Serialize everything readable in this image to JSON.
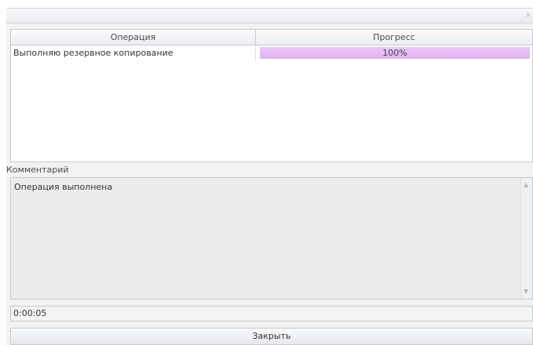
{
  "window": {
    "close_glyph": "×"
  },
  "grid": {
    "columns": [
      "Операция",
      "Прогресс"
    ],
    "rows": [
      {
        "operation": "Выполняю резервное копирование",
        "progress": 1.0,
        "progress_label": "100%"
      }
    ]
  },
  "comment": {
    "label": "Комментарий",
    "text": "Операция выполнена"
  },
  "elapsed": "0:00:05",
  "close_button": "Закрыть",
  "icons": [
    "close-icon",
    "scroll-up-arrow-icon",
    "scroll-down-arrow-icon"
  ],
  "colors": {
    "progress_fill": "#deb1f0",
    "progress_track": "#f3eaf8"
  }
}
